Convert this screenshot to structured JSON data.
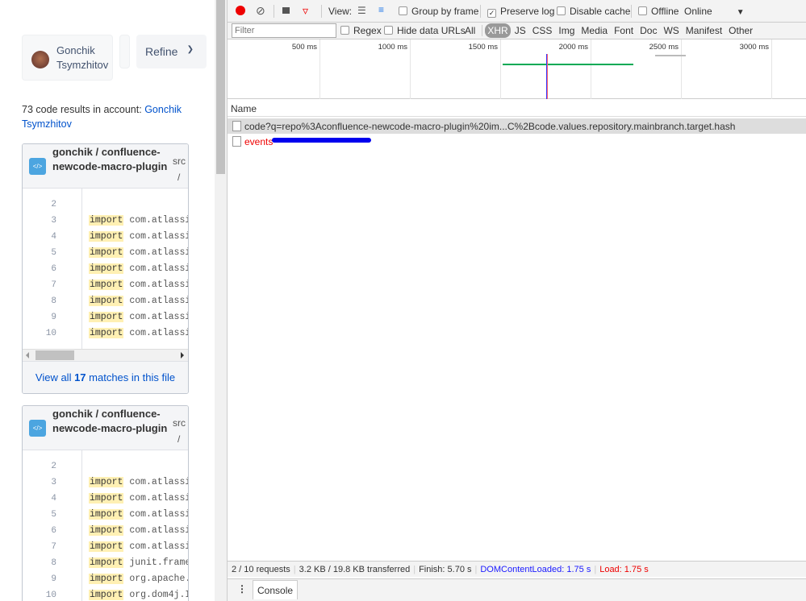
{
  "user": {
    "name_line1": "Gonchik",
    "name_line2": "Tsymzhitov"
  },
  "refine": {
    "label": "Refine"
  },
  "results": {
    "count_text": "73 code results",
    "in_text": " in account: ",
    "account": "Gonchik Tsymzhitov"
  },
  "cards": [
    {
      "owner": "gonchik",
      "sep": " / ",
      "repo": "confluence-newcode-macro-plugin",
      "path": "src",
      "path_sep": "/",
      "lines": [
        {
          "n": "2",
          "kw": "",
          "rest": ""
        },
        {
          "n": "3",
          "kw": "import",
          "rest": "com.atlassi"
        },
        {
          "n": "4",
          "kw": "import",
          "rest": "com.atlassi"
        },
        {
          "n": "5",
          "kw": "import",
          "rest": "com.atlassi"
        },
        {
          "n": "6",
          "kw": "import",
          "rest": "com.atlassi"
        },
        {
          "n": "7",
          "kw": "import",
          "rest": "com.atlassi"
        },
        {
          "n": "8",
          "kw": "import",
          "rest": "com.atlassi"
        },
        {
          "n": "9",
          "kw": "import",
          "rest": "com.atlassi"
        },
        {
          "n": "10",
          "kw": "import",
          "rest": "com.atlassi"
        }
      ],
      "footer": {
        "pre": "View all ",
        "count": "17",
        "post": " matches in this file"
      }
    },
    {
      "owner": "gonchik",
      "sep": " / ",
      "repo": "confluence-newcode-macro-plugin",
      "path": "src",
      "path_sep": "/",
      "lines": [
        {
          "n": "2",
          "kw": "",
          "rest": ""
        },
        {
          "n": "3",
          "kw": "import",
          "rest": "com.atlassi"
        },
        {
          "n": "4",
          "kw": "import",
          "rest": "com.atlassi"
        },
        {
          "n": "5",
          "kw": "import",
          "rest": "com.atlassi"
        },
        {
          "n": "6",
          "kw": "import",
          "rest": "com.atlassi"
        },
        {
          "n": "7",
          "kw": "import",
          "rest": "com.atlassi"
        },
        {
          "n": "8",
          "kw": "import",
          "rest": "junit.frame"
        },
        {
          "n": "9",
          "kw": "import",
          "rest": "org.apache."
        },
        {
          "n": "10",
          "kw": "import",
          "rest": "org.dom4j.I"
        }
      ]
    }
  ],
  "devtools": {
    "toolbar": {
      "view": "View:",
      "group_by_frame": "Group by frame",
      "preserve_log": "Preserve log",
      "preserve_log_checked": true,
      "disable_cache": "Disable cache",
      "offline": "Offline",
      "throttle": "Online"
    },
    "filter": {
      "placeholder": "Filter",
      "regex": "Regex",
      "hide_data_urls": "Hide data URLs",
      "types": [
        "All",
        "XHR",
        "JS",
        "CSS",
        "Img",
        "Media",
        "Font",
        "Doc",
        "WS",
        "Manifest",
        "Other"
      ],
      "active_type": "XHR"
    },
    "timeline": {
      "ticks": [
        "500 ms",
        "1000 ms",
        "1500 ms",
        "2000 ms",
        "2500 ms",
        "3000 ms"
      ],
      "dom_content_loaded_ms": 1750,
      "load_ms": 1750,
      "request_start_ms": 1510,
      "request_end_ms": 2230
    },
    "name_header": "Name",
    "requests": [
      {
        "name": "code?q=repo%3Aconfluence-newcode-macro-plugin%20im...C%2Bcode.values.repository.mainbranch.target.hash",
        "selected": true,
        "error": false
      },
      {
        "name": "events",
        "selected": false,
        "error": true
      }
    ],
    "status": {
      "requests": "2 / 10 requests",
      "transferred": "3.2 KB / 19.8 KB transferred",
      "finish": "Finish: 5.70 s",
      "dcl": "DOMContentLoaded: 1.75 s",
      "load": "Load: 1.75 s"
    },
    "drawer": {
      "tab": "Console"
    }
  }
}
